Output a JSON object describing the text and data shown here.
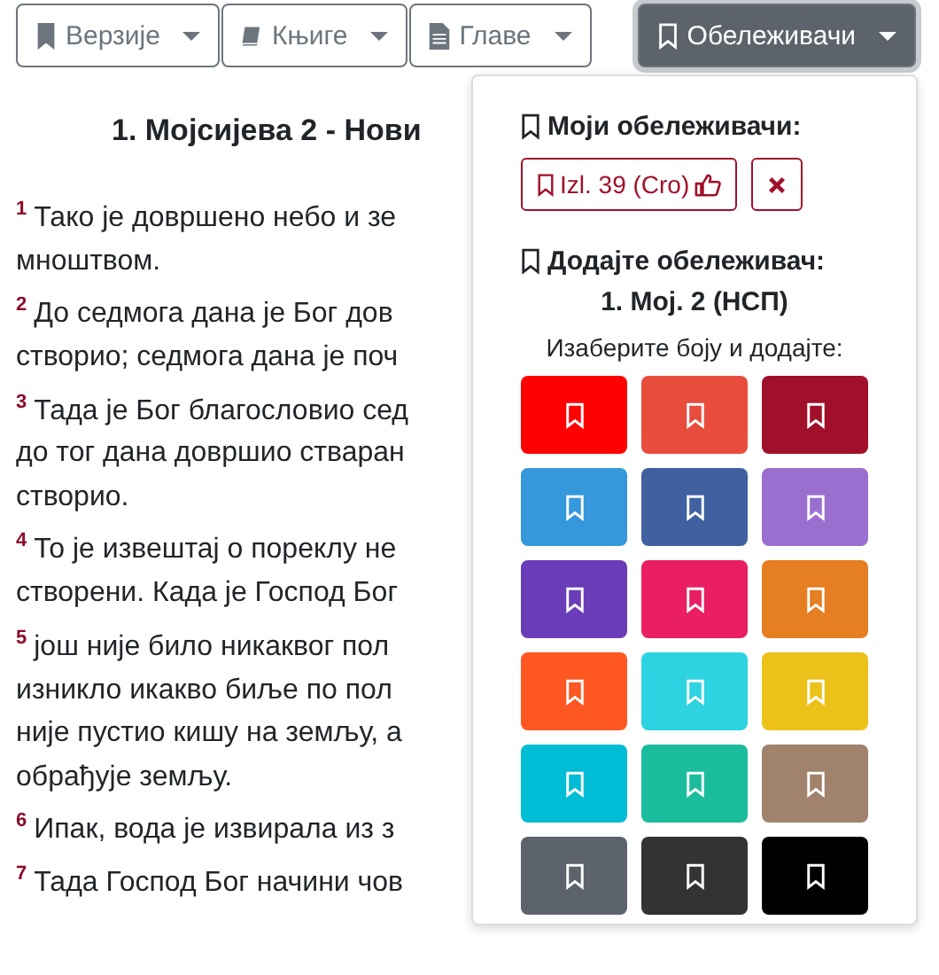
{
  "toolbar": [
    {
      "label": "Верзије",
      "kind": "bookmark"
    },
    {
      "label": "Књиге",
      "kind": "book"
    },
    {
      "label": "Главе",
      "kind": "file"
    }
  ],
  "bookmarks_button": {
    "label": "Обележивачи",
    "expanded": true
  },
  "heading": "1. Мојсијева 2 - Нови",
  "verses": [
    {
      "number": "1",
      "lines": [
        "Тако је довршено небо и зе",
        "мноштвом."
      ]
    },
    {
      "number": "2",
      "lines": [
        "До седмога дана је Бог дов",
        "створио; седмога дана је поч"
      ]
    },
    {
      "number": "3",
      "lines": [
        "Тада је Бог благословио сед",
        "до тог дана довршио стваран",
        "створио."
      ]
    },
    {
      "number": "4",
      "lines": [
        "То је извештај о пореклу не",
        "створени. Када је Господ Бог"
      ]
    },
    {
      "number": "5",
      "lines": [
        "још није било никаквог пол",
        "изникло икакво биље по пол",
        "није пустио кишу на земљу, а",
        "обрађује земљу."
      ]
    },
    {
      "number": "6",
      "lines": [
        "Ипак, вода је извирала из з"
      ]
    },
    {
      "number": "7",
      "lines": [
        "Тада Господ Бог начини чов"
      ]
    }
  ],
  "dropdown": {
    "my_title": "Моји обележивачи:",
    "my_bookmarks": [
      {
        "label": "Izl. 39 (Cro)"
      }
    ],
    "add_title": "Додајте обележивач:",
    "reference": "1. Moj. 2 (НСП)",
    "prompt": "Изаберите боју и додајте:",
    "colors": [
      {
        "color": "#ff0000"
      },
      {
        "color": "#e74c3c"
      },
      {
        "color": "#a0102a"
      },
      {
        "color": "#3498db"
      },
      {
        "color": "#4060a0"
      },
      {
        "color": "#9b6fcf"
      },
      {
        "color": "#6a3cb8"
      },
      {
        "color": "#e91e63"
      },
      {
        "color": "#e67e22"
      },
      {
        "color": "#ff5722"
      },
      {
        "color": "#2dd3e0"
      },
      {
        "color": "#ecc21a"
      },
      {
        "color": "#00bcd4"
      },
      {
        "color": "#1abc9c"
      },
      {
        "color": "#a0826d"
      },
      {
        "color": "#5c636a"
      },
      {
        "color": "#333333"
      },
      {
        "color": "#000000"
      }
    ]
  }
}
